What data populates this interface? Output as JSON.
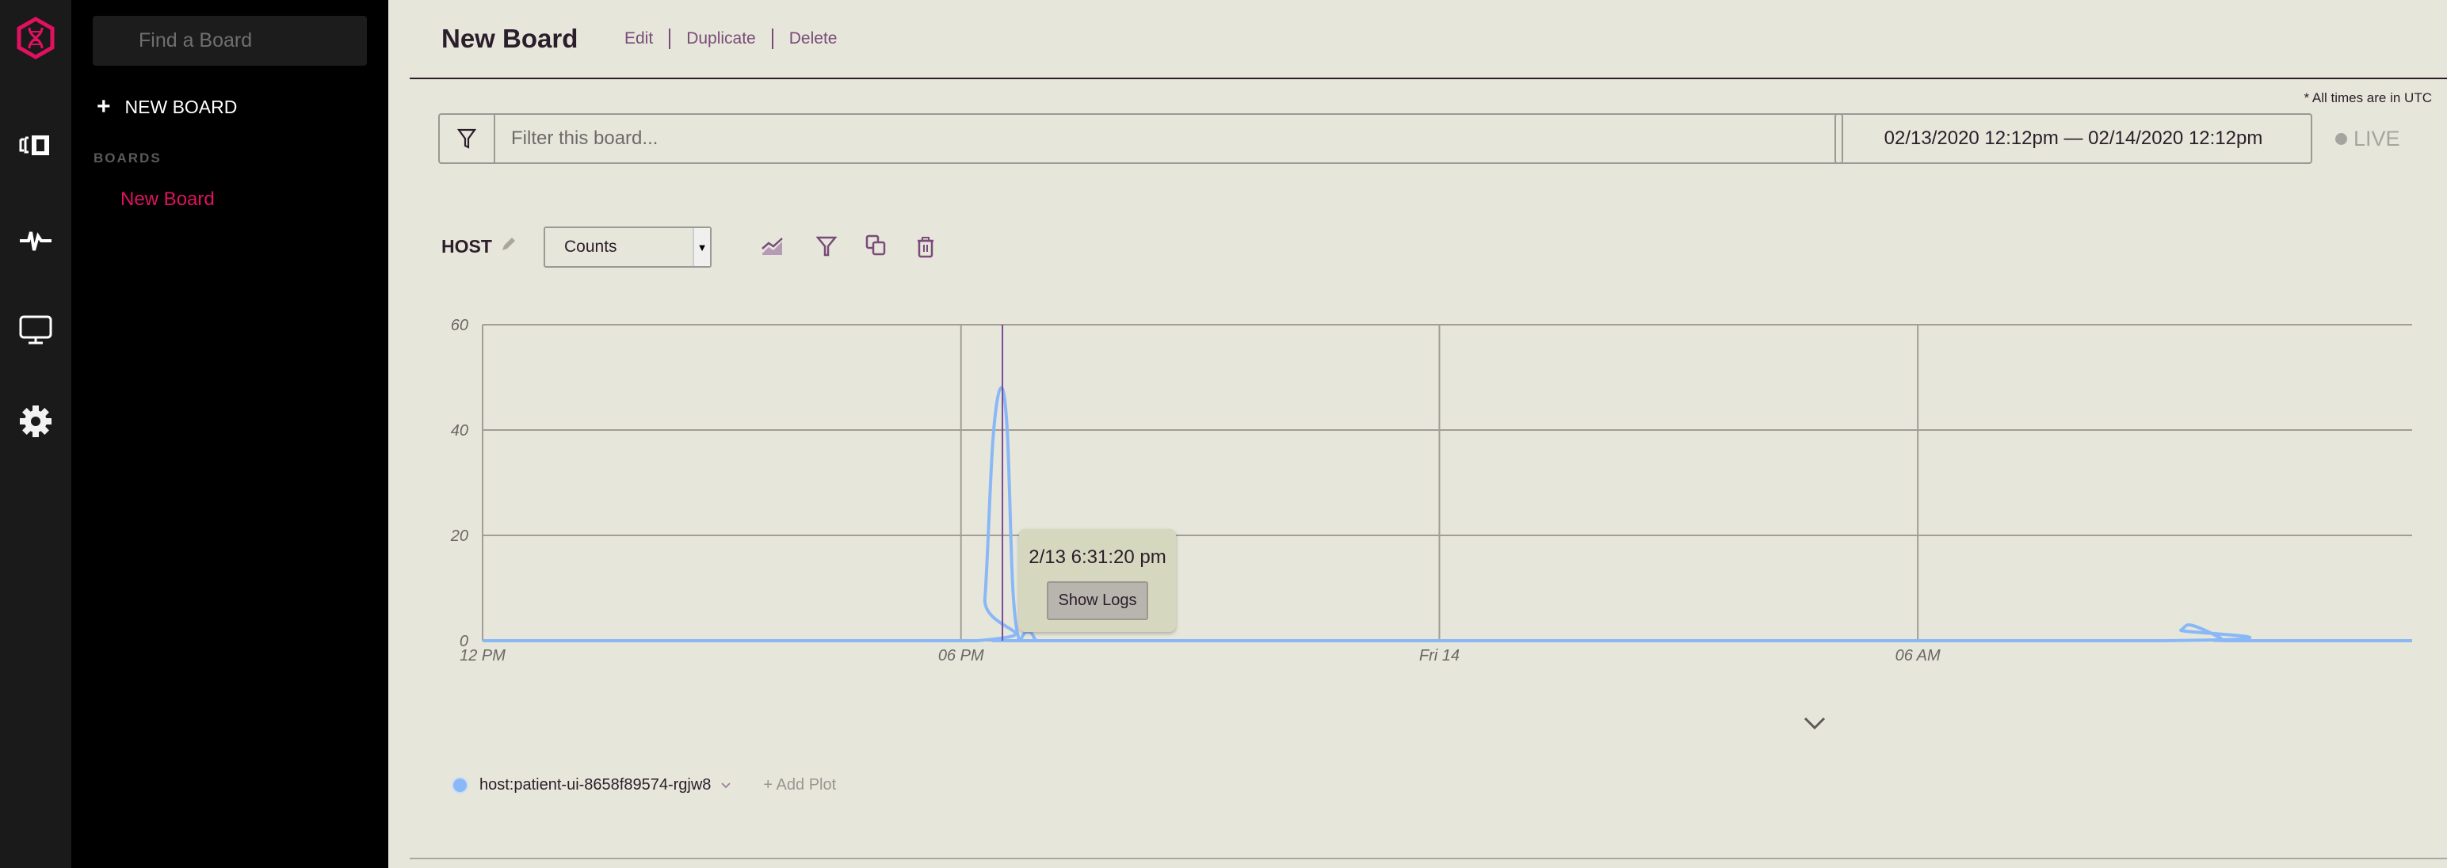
{
  "rail": {
    "icons": [
      "logo-icon",
      "boards-icon",
      "activity-icon",
      "monitor-icon",
      "settings-icon"
    ],
    "accent": "#e0115f"
  },
  "sidebar": {
    "search_placeholder": "Find a Board",
    "new_board_label": "NEW BOARD",
    "boards_heading": "BOARDS",
    "boards": [
      {
        "label": "New Board",
        "active": true
      }
    ]
  },
  "header": {
    "title": "New Board",
    "actions": [
      "Edit",
      "Duplicate",
      "Delete"
    ]
  },
  "toolbar": {
    "utc_note": "* All times are in UTC",
    "filter_placeholder": "Filter this board...",
    "date_range": "02/13/2020 12:12pm — 02/14/2020 12:12pm",
    "live_label": "LIVE"
  },
  "panel": {
    "title": "HOST",
    "metric_select": "Counts",
    "tools": [
      "area-chart-icon",
      "filter-icon",
      "duplicate-icon",
      "trash-icon"
    ]
  },
  "tooltip": {
    "time": "2/13 6:31:20 pm",
    "button": "Show Logs"
  },
  "legend": {
    "series_label": "host:patient-ui-8658f89574-rgjw8",
    "add_plot": "+ Add Plot"
  },
  "chart_data": {
    "type": "line",
    "title": "HOST",
    "xlabel": "",
    "ylabel": "Counts",
    "x_unit": "hours since 2/13 12:00 PM UTC",
    "xlim": [
      0,
      24.2
    ],
    "ylim": [
      0,
      60
    ],
    "yticks": [
      0,
      20,
      40,
      60
    ],
    "xticks": [
      {
        "value": 0,
        "label": "12 PM"
      },
      {
        "value": 6,
        "label": "06 PM"
      },
      {
        "value": 12,
        "label": "Fri 14"
      },
      {
        "value": 18,
        "label": "06 AM"
      }
    ],
    "grid": true,
    "cursor_x": 6.52,
    "series": [
      {
        "name": "host:patient-ui-8658f89574-rgjw8",
        "color": "#8ab8f7",
        "x": [
          0,
          6.2,
          6.3,
          6.4,
          6.5,
          6.58,
          6.65,
          6.73,
          6.8,
          6.88,
          6.95,
          7.1,
          7.2,
          7.5,
          21.1,
          21.3,
          21.4,
          21.6,
          21.8,
          21.9,
          24.2
        ],
        "values": [
          0,
          0,
          8,
          38,
          48,
          40,
          10,
          0,
          1.5,
          1.5,
          0,
          0,
          0,
          0,
          0,
          2,
          3,
          2,
          0.5,
          0,
          0
        ]
      }
    ]
  }
}
